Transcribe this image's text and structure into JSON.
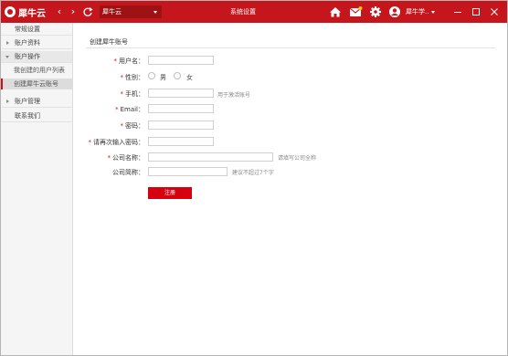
{
  "app": {
    "logo_text": "犀牛云",
    "address": "犀牛云",
    "window_title": "系统设置",
    "username": "犀牛学.."
  },
  "colors": {
    "brand": "#c4161c",
    "button": "#d7000f"
  },
  "sidebar": {
    "items": [
      {
        "label": "常规设置"
      },
      {
        "label": "账户资料"
      },
      {
        "label": "账户操作"
      },
      {
        "label": "我创建的用户列表"
      },
      {
        "label": "创建犀牛云账号"
      },
      {
        "label": "账户管理"
      },
      {
        "label": "联系我们"
      }
    ]
  },
  "form": {
    "title": "创建犀牛账号",
    "fields": {
      "username": {
        "label": "用户名："
      },
      "gender": {
        "label": "性别：",
        "male": "男",
        "female": "女"
      },
      "phone": {
        "label": "手机：",
        "hint": "用于激活账号"
      },
      "email": {
        "label": "Email："
      },
      "password": {
        "label": "密码："
      },
      "password_confirm": {
        "label": "请再次输入密码："
      },
      "company_name": {
        "label": "公司名称：",
        "hint": "请填写公司全称"
      },
      "company_short": {
        "label": "公司简称：",
        "hint": "建议不超过7个字"
      }
    },
    "submit_label": "注册"
  }
}
